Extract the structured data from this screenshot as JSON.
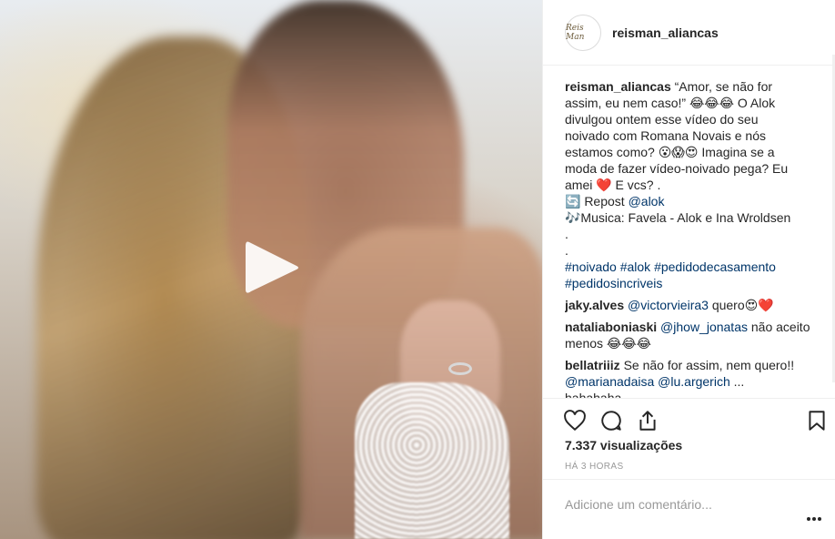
{
  "post": {
    "username": "reisman_aliancas",
    "avatar_text": "Reis Man",
    "caption_lines": [
      "“Amor, se não for",
      "assim, eu nem caso!” 😂😂😂 O Alok",
      "divulgou ontem esse vídeo do seu",
      "noivado com Romana Novais e nós",
      "estamos como? 😮😱😍 Imagina se a",
      "moda de fazer vídeo-noivado pega? Eu",
      "amei ❤️ E vcs? .",
      "🔄 Repost ",
      "🎶Musica: Favela - Alok e Ina Wroldsen",
      ".",
      "."
    ],
    "repost_user": "@alok",
    "hashtags_line1": "#noivado #alok #pedidodecasamento",
    "hashtags_line2": "#pedidosincriveis"
  },
  "comments": [
    {
      "user": "jaky.alves",
      "mention": "@victorvieira3",
      "text": " quero😍❤️"
    },
    {
      "user": "nataliaboniaski",
      "mention": "@jhow_jonatas",
      "text": " não aceito menos 😂😂😂"
    },
    {
      "user": "bellatriiiz",
      "text": " Se não for assim, nem quero!!",
      "mention1": "@marianadaisa",
      "mention2": "@lu.argerich",
      "tail": " ...",
      "clipped": "hahahaha"
    }
  ],
  "stats": {
    "views": "7.337 visualizações",
    "time": "HÁ 3 HORAS"
  },
  "add_comment": {
    "placeholder": "Adicione um comentário..."
  },
  "icons": [
    "play-icon",
    "heart-icon",
    "comment-icon",
    "share-icon",
    "bookmark-icon",
    "more-options-icon"
  ]
}
